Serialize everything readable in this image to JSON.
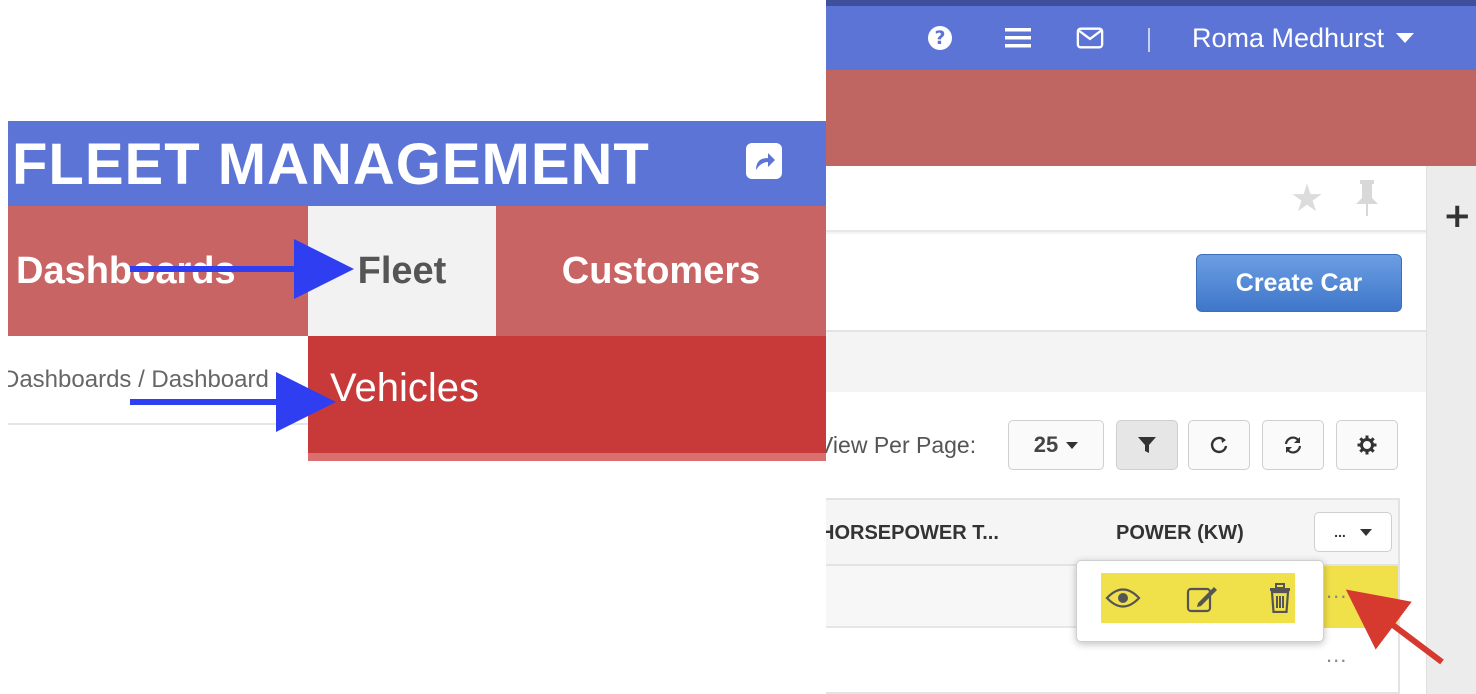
{
  "topbar": {
    "help_icon": "question-circle-icon",
    "menu_icon": "hamburger-icon",
    "mail_icon": "envelope-icon",
    "user_name": "Roma Medhurst"
  },
  "inset": {
    "title": "FLEET MANAGEMENT",
    "share_icon": "share-icon",
    "nav": {
      "dashboards": "Dashboards",
      "fleet": "Fleet",
      "customers": "Customers"
    },
    "breadcrumb": "Dashboards / Dashboard",
    "dropdown_item": "Vehicles"
  },
  "page": {
    "create_button": "Create Car",
    "pager_label": "View Per Page:",
    "per_page_value": "25",
    "columns": [
      "HORSEPOWER T...",
      "POWER (KW)"
    ],
    "column_menu_label": "...",
    "row_actions": [
      "view-icon",
      "edit-icon",
      "delete-icon"
    ],
    "row_ellipsis": "..."
  },
  "colors": {
    "topbar_blue": "#5b74d6",
    "nav_red": "#c86463",
    "dropdown_red": "#c83a3a",
    "primary_button": "#4a7fd0",
    "highlight_yellow": "#f0e04a",
    "arrow_blue": "#2e3ef0",
    "arrow_red": "#d63a2e"
  }
}
